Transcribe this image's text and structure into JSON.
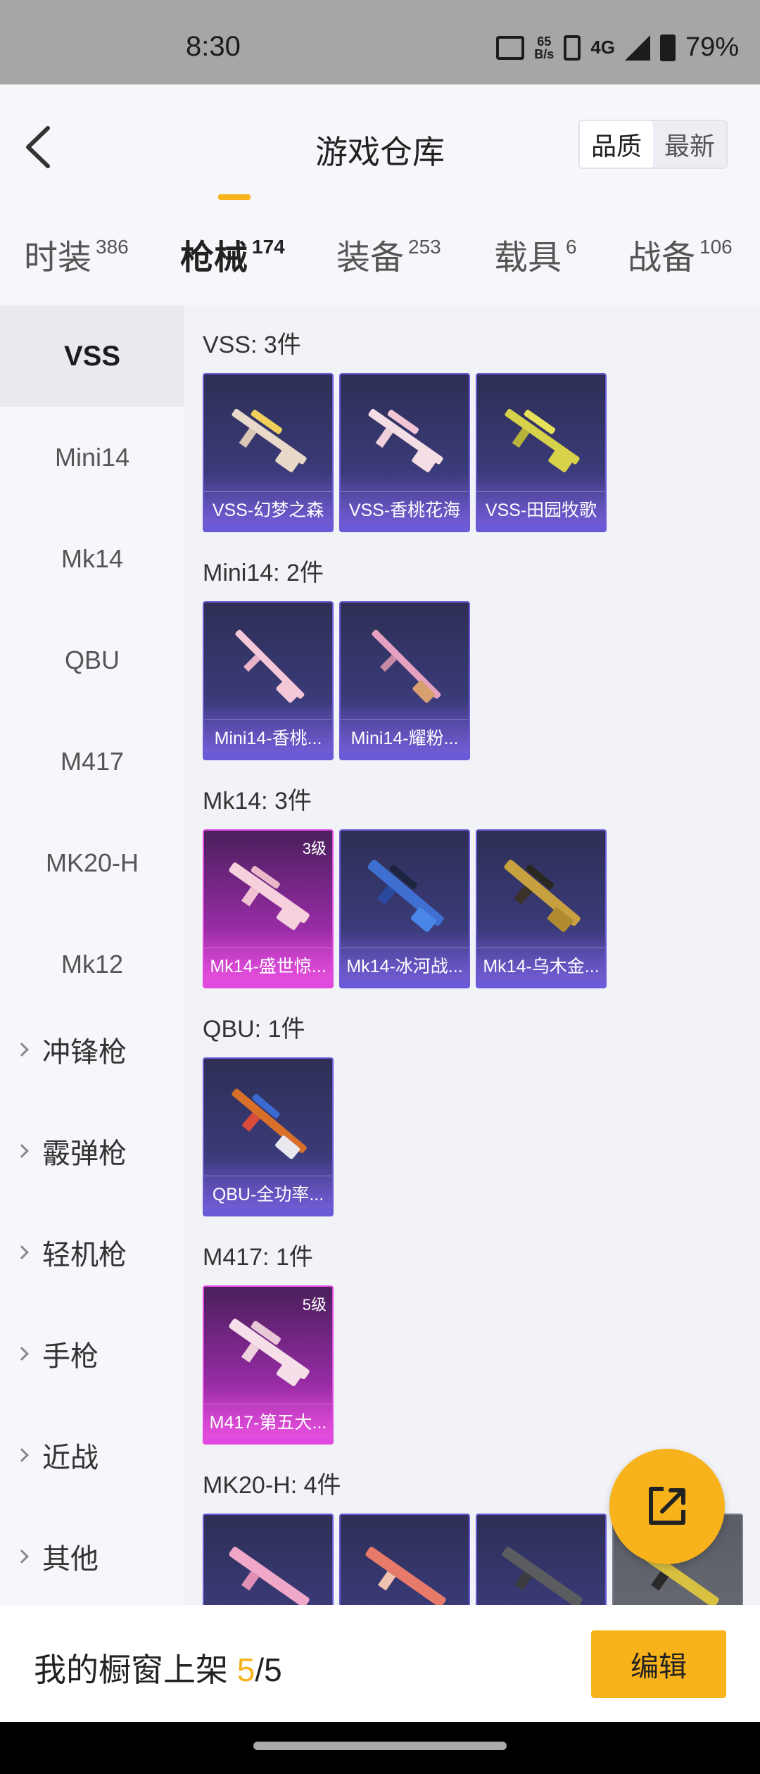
{
  "status_bar": {
    "time": "8:30",
    "net_speed_value": "65",
    "net_speed_unit": "B/s",
    "network": "4G",
    "battery": "79%"
  },
  "header": {
    "title": "游戏仓库",
    "sort_quality": "品质",
    "sort_newest": "最新"
  },
  "tabs": [
    {
      "label": "时装",
      "count": "386"
    },
    {
      "label": "枪械",
      "count": "174"
    },
    {
      "label": "装备",
      "count": "253"
    },
    {
      "label": "载具",
      "count": "6"
    },
    {
      "label": "战备",
      "count": "106"
    }
  ],
  "sidebar": {
    "items": [
      "VSS",
      "Mini14",
      "Mk14",
      "QBU",
      "M417",
      "MK20-H",
      "Mk12"
    ],
    "categories": [
      "冲锋枪",
      "霰弹枪",
      "轻机枪",
      "手枪",
      "近战",
      "其他"
    ]
  },
  "groups": [
    {
      "title": "VSS: 3件",
      "items": [
        {
          "name": "VSS-幻梦之森",
          "level": ""
        },
        {
          "name": "VSS-香桃花海",
          "level": ""
        },
        {
          "name": "VSS-田园牧歌",
          "level": ""
        }
      ]
    },
    {
      "title": "Mini14: 2件",
      "items": [
        {
          "name": "Mini14-香桃...",
          "level": ""
        },
        {
          "name": "Mini14-耀粉...",
          "level": ""
        }
      ]
    },
    {
      "title": "Mk14: 3件",
      "items": [
        {
          "name": "Mk14-盛世惊...",
          "level": "3级"
        },
        {
          "name": "Mk14-冰河战...",
          "level": ""
        },
        {
          "name": "Mk14-乌木金...",
          "level": ""
        }
      ]
    },
    {
      "title": "QBU: 1件",
      "items": [
        {
          "name": "QBU-全功率...",
          "level": ""
        }
      ]
    },
    {
      "title": "M417: 1件",
      "items": [
        {
          "name": "M417-第五大...",
          "level": "5级"
        }
      ]
    },
    {
      "title": "MK20-H: 4件",
      "items": []
    }
  ],
  "bottom_bar": {
    "label": "我的橱窗上架 ",
    "shown": "5",
    "total": "/5",
    "edit": "编辑"
  },
  "colors": {
    "accent": "#f8b21b",
    "card_purple": "#3a3a78",
    "card_pink": "#8e2a9c"
  }
}
